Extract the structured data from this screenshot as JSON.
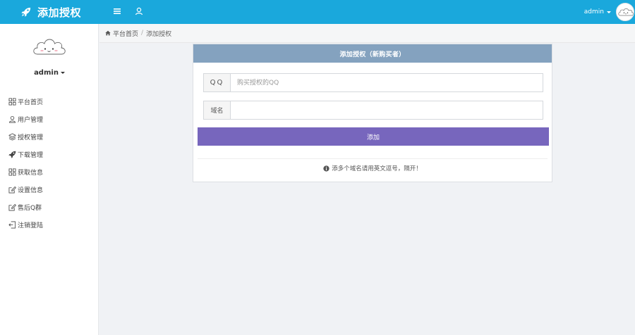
{
  "header": {
    "title": "添加授权",
    "brand_icon": "rocket-icon",
    "user_label": "admin",
    "icons": [
      "menu-toggle-icon",
      "user-icon"
    ],
    "color": "#1aa8dc"
  },
  "sidebar": {
    "user_label": "admin",
    "items": [
      {
        "label": "平台首页",
        "icon": "grid-icon"
      },
      {
        "label": "用户管理",
        "icon": "user-icon"
      },
      {
        "label": "授权管理",
        "icon": "layers-icon"
      },
      {
        "label": "下载管理",
        "icon": "rocket-icon"
      },
      {
        "label": "获取信息",
        "icon": "grid-icon"
      },
      {
        "label": "设置信息",
        "icon": "edit-icon"
      },
      {
        "label": "售后Q群",
        "icon": "edit-icon"
      },
      {
        "label": "注销登陆",
        "icon": "logout-icon"
      }
    ]
  },
  "breadcrumb": {
    "home": "平台首页",
    "separator": "/",
    "current": "添加授权"
  },
  "panel": {
    "heading": "添加授权（新购买者）",
    "heading_color": "#84a2bf",
    "qq": {
      "label": "QQ",
      "placeholder": "购买授权的QQ",
      "value": ""
    },
    "domain": {
      "label": "域名",
      "placeholder": "",
      "value": ""
    },
    "submit_label": "添加",
    "submit_color": "#7766bd",
    "tip": "添多个域名请用英文逗号，隔开！",
    "tip_icon": "info-circle-icon"
  }
}
